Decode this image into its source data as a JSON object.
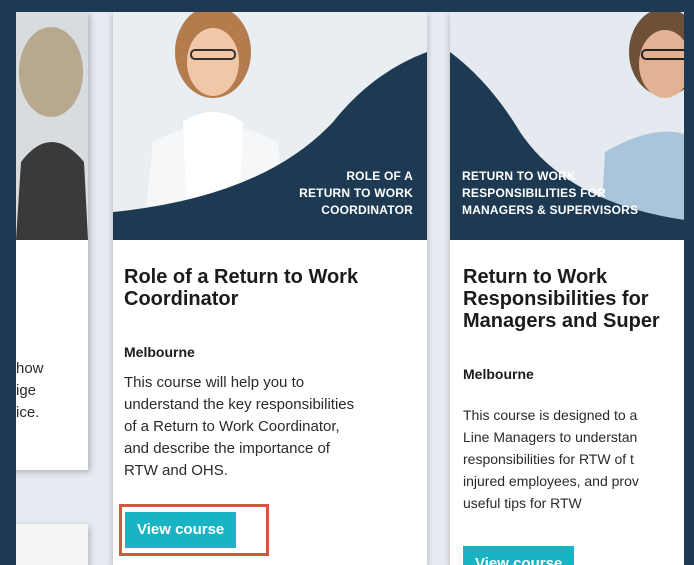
{
  "courses": [
    {
      "banner_lines": [
        "ROLE OF A",
        "RETURN TO WORK",
        "COORDINATOR"
      ],
      "title_lines": [
        "Role of a Return to Work",
        "Coordinator"
      ],
      "location": "Melbourne",
      "description_lines": [
        "This course will help you to",
        "understand the key responsibilities",
        "of a Return to Work Coordinator,",
        "and describe the importance of",
        "RTW and OHS."
      ],
      "button_label": "View course"
    },
    {
      "banner_lines": [
        "RETURN TO WORK",
        "RESPONSIBILITIES FOR",
        "MANAGERS & SUPERVISORS"
      ],
      "title_lines": [
        "Return to Work",
        "Responsibilities for",
        "Managers and Super"
      ],
      "location": "Melbourne",
      "description_lines": [
        "This course is designed to a",
        "Line Managers to understan",
        "responsibilities for RTW of t",
        "injured employees, and prov",
        "useful tips for RTW"
      ],
      "button_label": "View course"
    }
  ],
  "left_card": {
    "text_lines": [
      "how",
      "ige",
      "ice."
    ]
  },
  "colors": {
    "navy": "#1d3a52",
    "teal_button": "#19b3c3",
    "highlight": "#d05a3f"
  }
}
